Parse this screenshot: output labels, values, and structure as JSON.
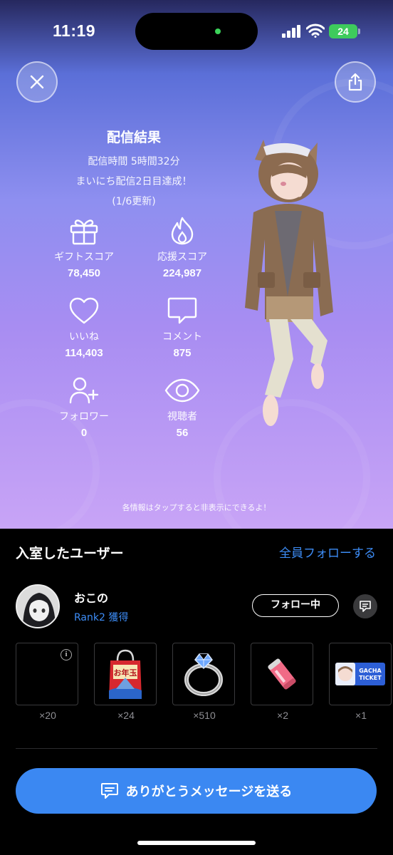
{
  "status_bar": {
    "time": "11:19",
    "battery": "24"
  },
  "header": {
    "close_icon": "close-icon",
    "share_icon": "share-icon"
  },
  "results": {
    "title": "配信結果",
    "duration": "配信時間 5時間32分",
    "streak": "まいにち配信2日目達成！",
    "updated": "(1/6更新)"
  },
  "stats": {
    "gift_score": {
      "label": "ギフトスコア",
      "value": "78,450",
      "icon": "gift-icon"
    },
    "support_score": {
      "label": "応援スコア",
      "value": "224,987",
      "icon": "flame-icon"
    },
    "likes": {
      "label": "いいね",
      "value": "114,403",
      "icon": "heart-icon"
    },
    "comments": {
      "label": "コメント",
      "value": "875",
      "icon": "comment-icon"
    },
    "followers": {
      "label": "フォロワー",
      "value": "0",
      "icon": "add-user-icon"
    },
    "viewers": {
      "label": "視聴者",
      "value": "56",
      "icon": "eye-icon"
    }
  },
  "hint": "各情報はタップすると非表示にできるよ！",
  "visitors": {
    "title": "入室したユーザー",
    "follow_all": "全員フォローする",
    "user": {
      "name": "おこの",
      "rank": "Rank2 獲得",
      "follow_status": "フォロー中"
    },
    "gifts": [
      {
        "icon": "empty-gift-slot",
        "count": "×20"
      },
      {
        "icon": "lucky-bag-icon",
        "count": "×24",
        "bag_text": "お年玉"
      },
      {
        "icon": "diamond-ring-icon",
        "count": "×510"
      },
      {
        "icon": "energy-drink-icon",
        "count": "×2"
      },
      {
        "icon": "gacha-ticket-icon",
        "count": "×1",
        "ticket_text_1": "GACHA",
        "ticket_text_2": "TICKET"
      }
    ]
  },
  "thanks_button": {
    "label": "ありがとうメッセージを送る"
  },
  "colors": {
    "accent": "#3b88f2",
    "link": "#3d8cf5",
    "battery": "#3ecb5c"
  }
}
